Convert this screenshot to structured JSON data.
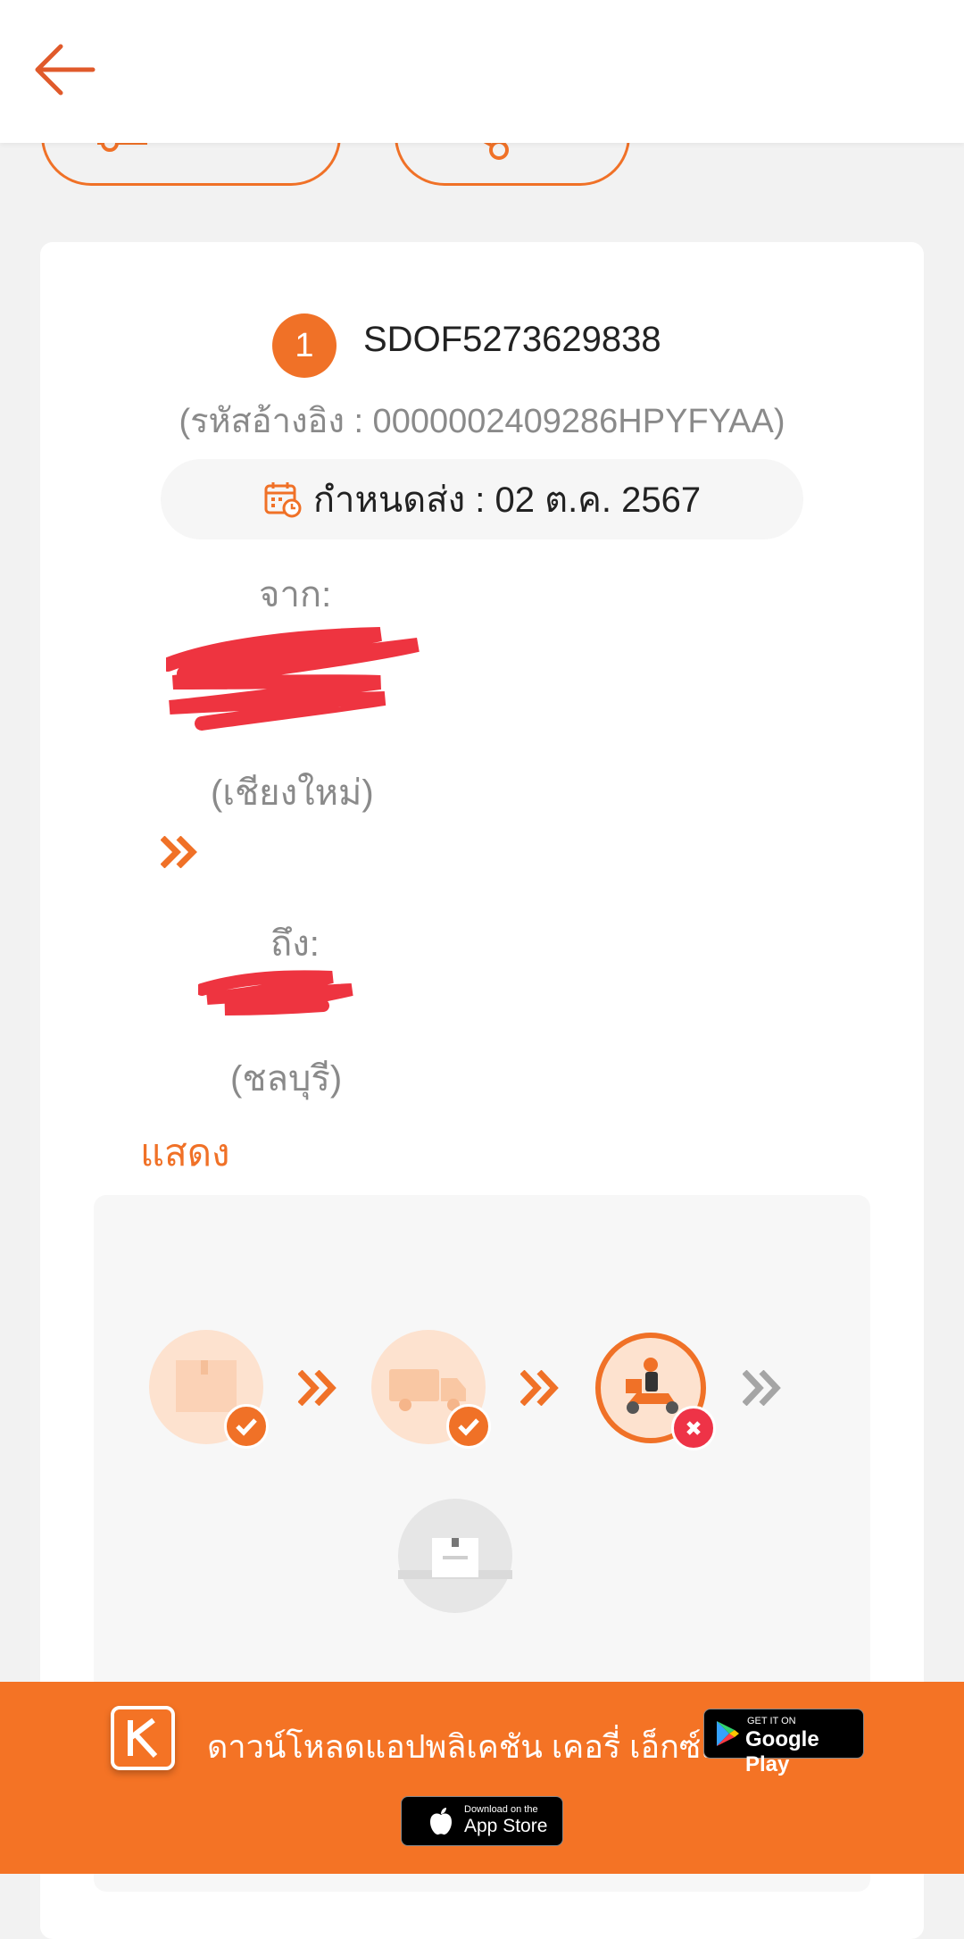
{
  "header": {
    "back_icon": "arrow-left-icon"
  },
  "actions": [
    {
      "name": "contact-button",
      "icon": "contact-icon"
    },
    {
      "name": "share-button",
      "icon": "share-icon"
    }
  ],
  "parcel": {
    "index": "1",
    "tracking_number": "SDOF5273629838",
    "reference": "(รหัสอ้างอิง : 0000002409286HPYFYAA)",
    "due_date": "กำหนดส่ง : 02 ต.ค. 2567",
    "from_label": "จาก:",
    "from_province": "(เชียงใหม่)",
    "to_label": "ถึง:",
    "to_province": "(ชลบุรี)",
    "show_label": "แสดง"
  },
  "timeline": {
    "steps": [
      {
        "name": "picked-up",
        "icon": "parcel-box-icon",
        "status": "done"
      },
      {
        "name": "in-transit",
        "icon": "delivery-truck-icon",
        "status": "done"
      },
      {
        "name": "out-for-delivery",
        "icon": "delivery-scooter-icon",
        "status": "failed"
      },
      {
        "name": "delivered",
        "icon": "parcel-box-icon",
        "status": "pending"
      }
    ]
  },
  "footer": {
    "download_text": "ดาวน์โหลดแอปพลิเคชัน เคอรี่ เอ็กซ์เพรส",
    "google_play_small": "GET IT ON",
    "google_play_big": "Google Play",
    "app_store_small": "Download on the",
    "app_store_big": "App Store"
  },
  "colors": {
    "accent": "#f07127",
    "footer": "#f47325",
    "error": "#ee3347",
    "pending": "#a5a5a5"
  }
}
